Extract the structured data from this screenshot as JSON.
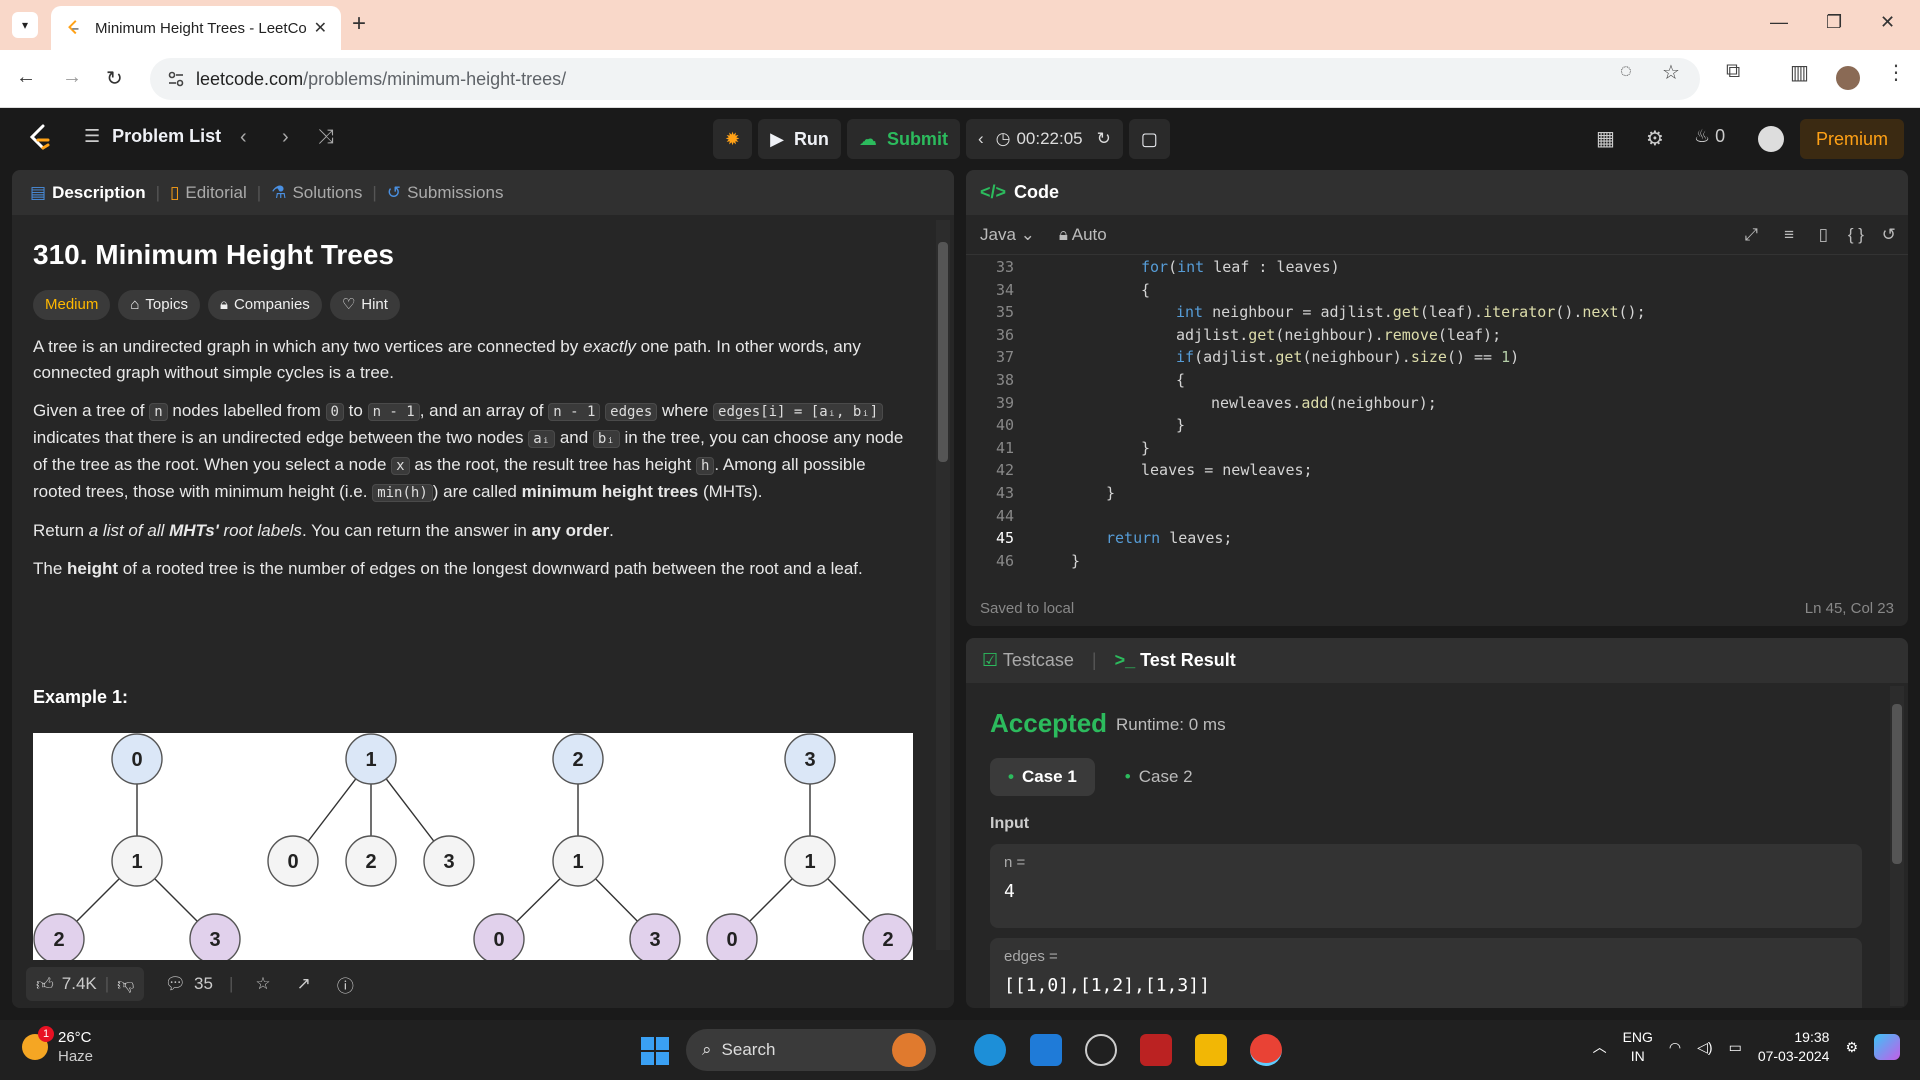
{
  "browser": {
    "tab_title": "Minimum Height Trees - LeetCo",
    "url_host": "leetcode.com",
    "url_path": "/problems/minimum-height-trees/"
  },
  "lc_nav": {
    "problem_list": "Problem List",
    "run": "Run",
    "submit": "Submit",
    "timer": "00:22:05",
    "streak": "0",
    "premium": "Premium"
  },
  "left_tabs": [
    "Description",
    "Editorial",
    "Solutions",
    "Submissions"
  ],
  "problem": {
    "title": "310. Minimum Height Trees",
    "difficulty": "Medium",
    "chips": [
      "Topics",
      "Companies",
      "Hint"
    ],
    "p1_a": "A tree is an undirected graph in which any two vertices are connected by ",
    "p1_em": "exactly",
    "p1_b": " one path. In other words, any connected graph without simple cycles is a tree.",
    "p2_a": "Given a tree of ",
    "p2_n": "n",
    "p2_b": " nodes labelled from ",
    "p2_0": "0",
    "p2_c": " to ",
    "p2_n1": "n - 1",
    "p2_d": ", and an array of ",
    "p2_n1b": "n - 1",
    "p2_edges": "edges",
    "p2_e": " where ",
    "p2_edgei": "edges[i] = [aᵢ, bᵢ]",
    "p2_f": " indicates that there is an undirected edge between the two nodes ",
    "p2_ai": "aᵢ",
    "p2_g": " and ",
    "p2_bi": "bᵢ",
    "p2_h": " in the tree, you can choose any node of the tree as the root. When you select a node ",
    "p2_x": "x",
    "p2_i": " as the root, the result tree has height ",
    "p2_hh": "h",
    "p2_j": ". Among all possible rooted trees, those with minimum height (i.e. ",
    "p2_minh": "min(h)",
    "p2_k": ")  are called ",
    "p2_mht": "minimum height trees",
    "p2_l": " (MHTs).",
    "p3_a": "Return ",
    "p3_em": "a list of all ",
    "p3_emb": "MHTs'",
    "p3_em2": " root labels",
    "p3_b": ". You can return the answer in ",
    "p3_bold": "any order",
    "p3_c": ".",
    "p4_a": "The ",
    "p4_bold": "height",
    "p4_b": " of a rooted tree is the number of edges on the longest downward path between the root and a leaf.",
    "example_title": "Example 1:"
  },
  "trees": [
    {
      "root": "0",
      "mid": "1",
      "leaves": [
        "2",
        "3"
      ]
    },
    {
      "root": "1",
      "leaves": [
        "0",
        "2",
        "3"
      ]
    },
    {
      "root": "2",
      "mid": "1",
      "leaves": [
        "0",
        "3"
      ]
    },
    {
      "root": "3",
      "mid": "1",
      "leaves": [
        "0",
        "2"
      ]
    }
  ],
  "left_footer": {
    "likes": "7.4K",
    "comments": "35"
  },
  "code": {
    "header": "Code",
    "language": "Java",
    "mode": "Auto",
    "saved": "Saved to local",
    "position": "Ln 45, Col 23",
    "current_line": 45,
    "lines": [
      {
        "n": "33",
        "indent": 3,
        "text": "for(int leaf : leaves)"
      },
      {
        "n": "34",
        "indent": 3,
        "text": "{"
      },
      {
        "n": "35",
        "indent": 4,
        "text": "int neighbour = adjlist.get(leaf).iterator().next();"
      },
      {
        "n": "36",
        "indent": 4,
        "text": "adjlist.get(neighbour).remove(leaf);"
      },
      {
        "n": "37",
        "indent": 4,
        "text": "if(adjlist.get(neighbour).size() == 1)"
      },
      {
        "n": "38",
        "indent": 4,
        "text": "{"
      },
      {
        "n": "39",
        "indent": 5,
        "text": "newleaves.add(neighbour);"
      },
      {
        "n": "40",
        "indent": 4,
        "text": "}"
      },
      {
        "n": "41",
        "indent": 3,
        "text": "}"
      },
      {
        "n": "42",
        "indent": 3,
        "text": "leaves = newleaves;"
      },
      {
        "n": "43",
        "indent": 2,
        "text": "}"
      },
      {
        "n": "44",
        "indent": 0,
        "text": ""
      },
      {
        "n": "45",
        "indent": 2,
        "text": "return leaves;"
      },
      {
        "n": "46",
        "indent": 1,
        "text": "}"
      }
    ]
  },
  "test": {
    "tab_testcase": "Testcase",
    "tab_result": "Test Result",
    "status": "Accepted",
    "runtime": "Runtime: 0 ms",
    "cases": [
      "Case 1",
      "Case 2"
    ],
    "input_label": "Input",
    "n_label": "n =",
    "n_value": "4",
    "edges_label": "edges =",
    "edges_value": "[[1,0],[1,2],[1,3]]"
  },
  "taskbar": {
    "temp": "26°C",
    "weather": "Haze",
    "notif": "1",
    "search": "Search",
    "lang1": "ENG",
    "lang2": "IN",
    "time": "19:38",
    "date": "07-03-2024"
  },
  "colors": {
    "accent_green": "#2cbb5d",
    "medium": "#ffb800",
    "premium": "#ffa116",
    "node_fill": "#dbe7f7",
    "leaf_fill": "#e1d1ec"
  }
}
